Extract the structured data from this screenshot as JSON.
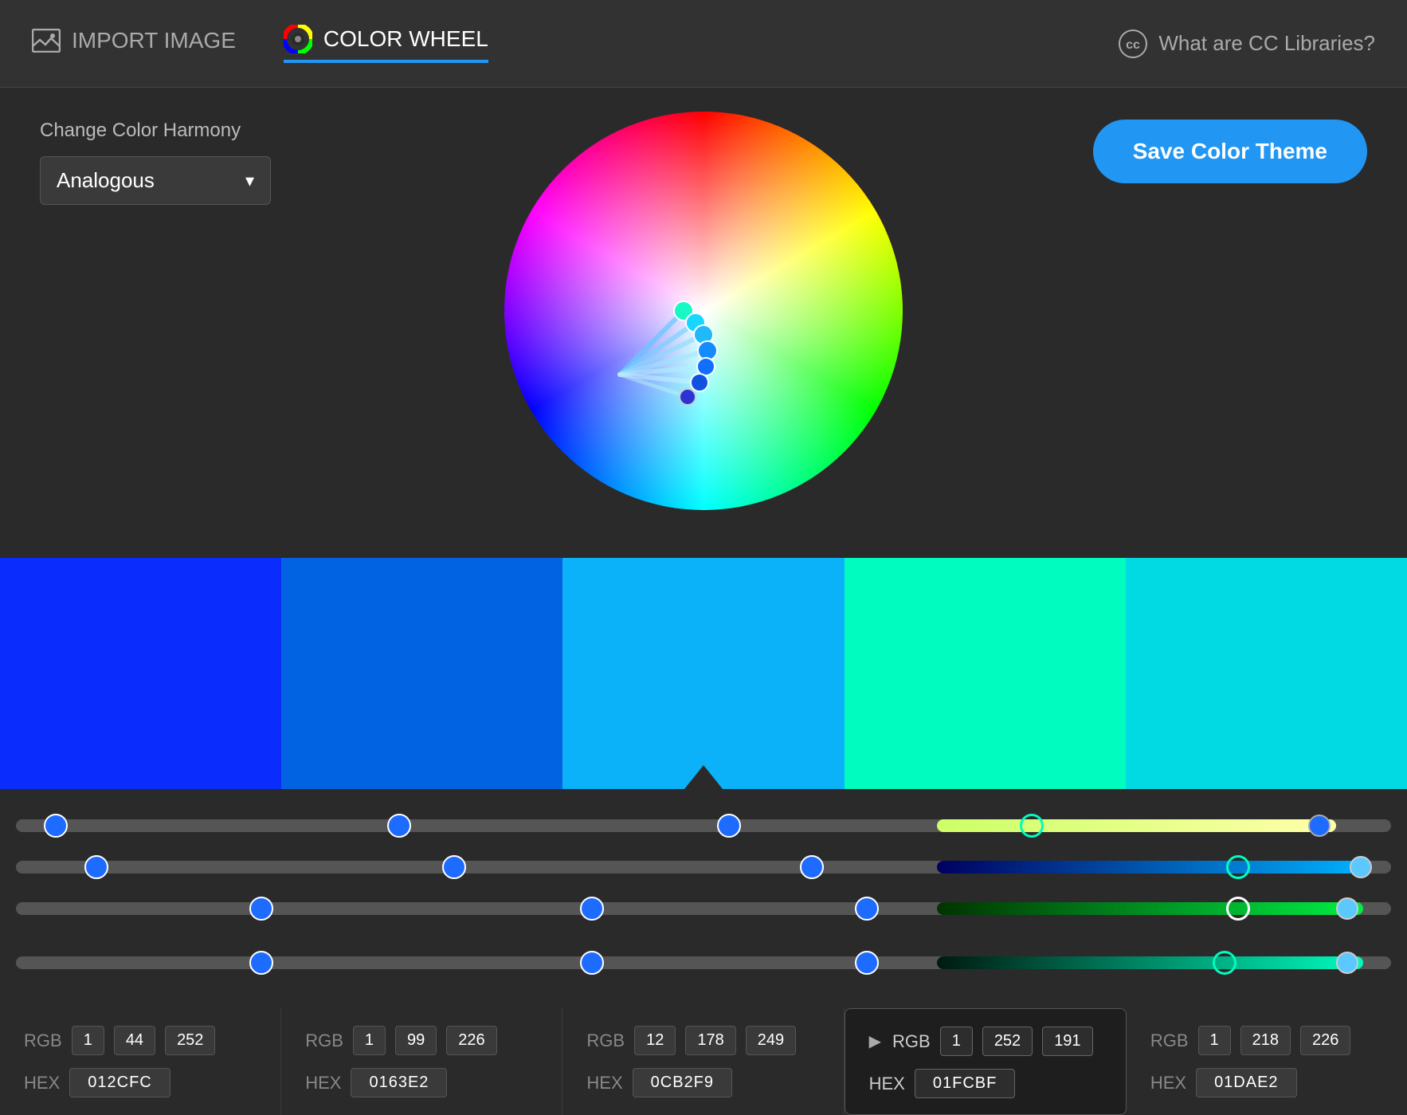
{
  "header": {
    "import_label": "IMPORT IMAGE",
    "wheel_label": "COLOR WHEEL",
    "cc_label": "What are CC Libraries?"
  },
  "controls": {
    "harmony_label": "Change Color Harmony",
    "harmony_value": "Analogous",
    "save_button": "Save Color Theme"
  },
  "swatches": [
    {
      "id": 1,
      "color": "#0a2cfc",
      "rgb": [
        1,
        44,
        252
      ],
      "hex": "012CFC",
      "active": false
    },
    {
      "id": 2,
      "color": "#0163e2",
      "rgb": [
        1,
        99,
        226
      ],
      "hex": "0163E2",
      "active": false
    },
    {
      "id": 3,
      "color": "#0cb2f9",
      "rgb": [
        12,
        178,
        249
      ],
      "hex": "0CB2F9",
      "active": true
    },
    {
      "id": 4,
      "color": "#01fcbf",
      "rgb": [
        1,
        252,
        191
      ],
      "hex": "01FCBF",
      "active": false
    },
    {
      "id": 5,
      "color": "#01dae2",
      "rgb": [
        1,
        218,
        226
      ],
      "hex": "01DAE2",
      "active": false
    }
  ],
  "active_swatch_index": 3,
  "sliders": {
    "row1": {
      "positions": [
        0.02,
        0.28,
        0.52,
        0.78,
        0.96
      ]
    },
    "row2": {
      "positions": [
        0.05,
        0.32,
        0.58,
        0.85,
        0.97
      ]
    },
    "row3": {
      "positions": [
        0.18,
        0.42,
        0.62,
        0.88,
        0.96
      ]
    },
    "row4": {
      "positions": [
        0.18,
        0.42,
        0.62,
        0.86,
        0.97
      ]
    }
  }
}
